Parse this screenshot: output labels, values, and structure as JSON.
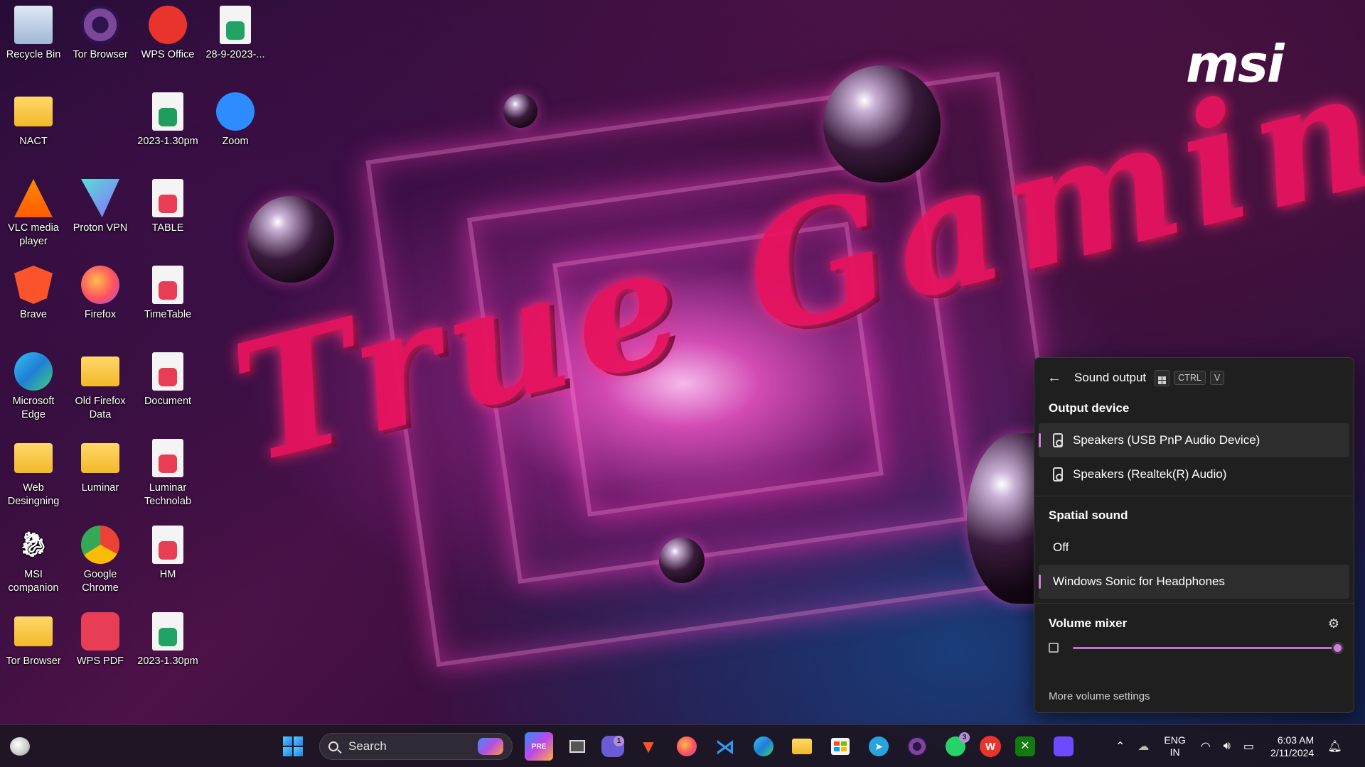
{
  "desktop": {
    "icons": [
      {
        "label": "Recycle Bin",
        "icon": "recycle-bin-icon"
      },
      {
        "label": "Tor Browser",
        "icon": "tor-browser-icon"
      },
      {
        "label": "WPS Office",
        "icon": "wps-office-icon"
      },
      {
        "label": "28-9-2023-...",
        "icon": "spreadsheet-file-icon"
      },
      {
        "label": "NACT",
        "icon": "folder-icon"
      },
      {
        "label": "2023-1.30pm",
        "icon": "et-document-icon"
      },
      {
        "label": "Zoom",
        "icon": "zoom-icon"
      },
      {
        "label": "VLC media player",
        "icon": "vlc-icon"
      },
      {
        "label": "Proton VPN",
        "icon": "proton-vpn-icon"
      },
      {
        "label": "TABLE",
        "icon": "wps-pdf-file-icon"
      },
      {
        "label": "Brave",
        "icon": "brave-icon"
      },
      {
        "label": "Firefox",
        "icon": "firefox-icon"
      },
      {
        "label": "TimeTable",
        "icon": "wps-pdf-file-icon"
      },
      {
        "label": "Microsoft Edge",
        "icon": "edge-icon"
      },
      {
        "label": "Old Firefox Data",
        "icon": "folder-icon"
      },
      {
        "label": "Document",
        "icon": "wps-pdf-file-icon"
      },
      {
        "label": "Web Desingning",
        "icon": "folder-icon"
      },
      {
        "label": "Luminar",
        "icon": "folder-icon"
      },
      {
        "label": "Luminar Technolab",
        "icon": "wps-pdf-file-icon"
      },
      {
        "label": "MSI companion",
        "icon": "msi-dragon-icon"
      },
      {
        "label": "Google Chrome",
        "icon": "chrome-icon"
      },
      {
        "label": "HM",
        "icon": "wps-pdf-file-icon"
      },
      {
        "label": "Tor Browser",
        "icon": "tor-folder-icon"
      },
      {
        "label": "WPS PDF",
        "icon": "wps-pdf-icon"
      },
      {
        "label": "2023-1.30pm",
        "icon": "spreadsheet-file-icon"
      }
    ],
    "wallpaper": {
      "brand": "msi",
      "slogan": "True Gaming"
    }
  },
  "sound_panel": {
    "title": "Sound output",
    "shortcut_keys": [
      "CTRL",
      "V"
    ],
    "output_device_heading": "Output device",
    "devices": [
      {
        "label": "Speakers (USB PnP Audio Device)",
        "active": true
      },
      {
        "label": "Speakers (Realtek(R) Audio)",
        "active": false
      }
    ],
    "spatial_heading": "Spatial sound",
    "spatial_options": [
      {
        "label": "Off",
        "active": false
      },
      {
        "label": "Windows Sonic for Headphones",
        "active": true
      }
    ],
    "mixer_heading": "Volume mixer",
    "volume_level": 1.0,
    "more_settings": "More volume settings",
    "accent_color": "#d17ee0"
  },
  "taskbar": {
    "search_placeholder": "Search",
    "chat_badge": "1",
    "whatsapp_badge": "3",
    "language": "ENG",
    "region": "IN",
    "time": "6:03 AM",
    "date": "2/11/2024"
  }
}
